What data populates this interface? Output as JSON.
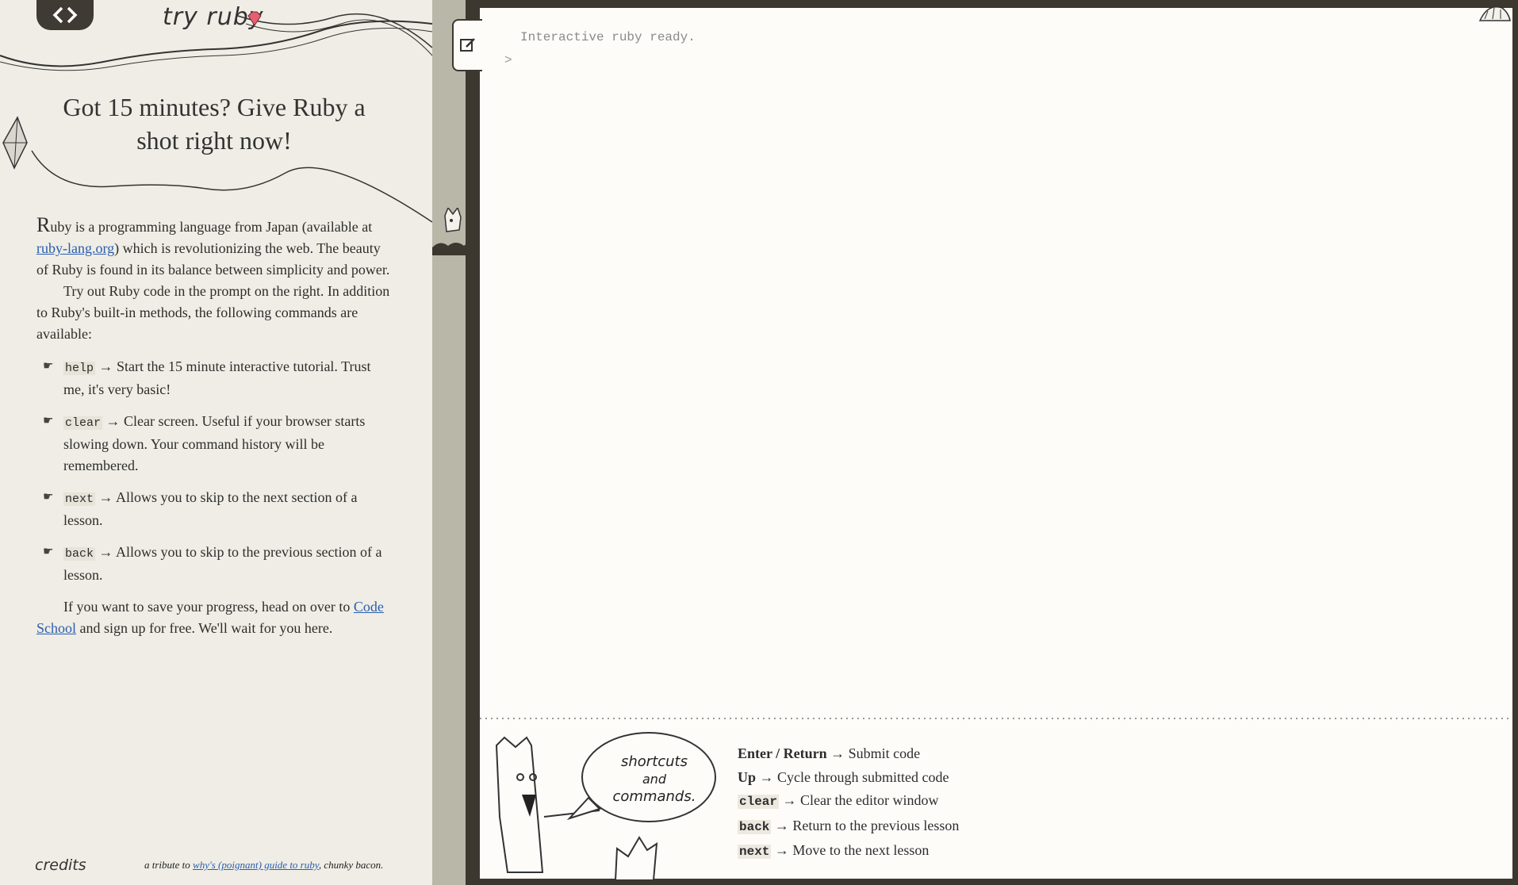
{
  "header": {
    "brand": "try ruby",
    "headline": "Got 15 minutes? Give Ruby a shot right now!"
  },
  "intro": {
    "dropcap": "R",
    "p1_a": "uby is a programming language from Japan (available at ",
    "link_ruby": "ruby-lang.org",
    "p1_b": ") which is revolutionizing the web. The beauty of Ruby is found in its balance between simplicity and power.",
    "p2": "Try out Ruby code in the prompt on the right. In addition to Ruby's built-in methods, the following commands are available:"
  },
  "commands": [
    {
      "cmd": "help",
      "desc": " → Start the 15 minute interactive tutorial. Trust me, it's very basic!"
    },
    {
      "cmd": "clear",
      "desc": " → Clear screen. Useful if your browser starts slowing down. Your command history will be remembered."
    },
    {
      "cmd": "next",
      "desc": " → Allows you to skip to the next section of a lesson."
    },
    {
      "cmd": "back",
      "desc": " → Allows you to skip to the previous section of a lesson."
    }
  ],
  "save": {
    "text_a": "If you want to save your progress, head on over to ",
    "link_codeschool": "Code School",
    "text_b": " and sign up for free. We'll wait for you here."
  },
  "footer": {
    "credits": "credits",
    "tribute_a": "a tribute to ",
    "tribute_link": "why's (poignant) guide to ruby",
    "tribute_b": ", chunky bacon."
  },
  "console": {
    "ready": "Interactive ruby ready.",
    "prompt": ">"
  },
  "bubble": {
    "line1": "shortcuts",
    "line2": "and",
    "line3": "commands."
  },
  "shortcuts": [
    {
      "key": "Enter / Return",
      "type": "bold",
      "desc": " → Submit code"
    },
    {
      "key": "Up",
      "type": "bold",
      "desc": " → Cycle through submitted code"
    },
    {
      "key": "clear",
      "type": "code",
      "desc": " → Clear the editor window"
    },
    {
      "key": "back",
      "type": "code",
      "desc": " → Return to the previous lesson"
    },
    {
      "key": "next",
      "type": "code",
      "desc": " → Move to the next lesson"
    }
  ],
  "colors": {
    "link": "#2a5db0",
    "frame": "#3c3830",
    "paper": "#efede5"
  }
}
